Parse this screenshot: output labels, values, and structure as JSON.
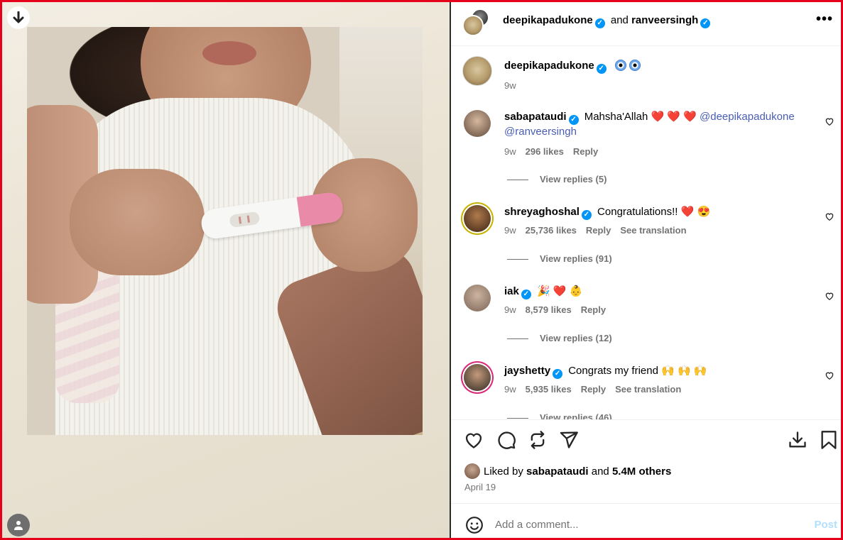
{
  "media": {
    "download_icon": "down-arrow-icon",
    "user_icon": "person-icon"
  },
  "header": {
    "user1": "deepikapadukone",
    "joiner": "and",
    "user2": "ranveersingh",
    "more": "•••"
  },
  "caption": {
    "username": "deepikapadukone",
    "emoji_icons": [
      "nazar-amulet-icon",
      "nazar-amulet-icon"
    ],
    "time": "9w"
  },
  "comments": [
    {
      "username": "sabapataudi",
      "text": "Mahsha'Allah ❤️ ❤️ ❤️",
      "mentions": [
        "@deepikapadukone",
        "@ranveersingh"
      ],
      "time": "9w",
      "likes": "296 likes",
      "reply": "Reply",
      "translate": "",
      "view_replies": "View replies (5)"
    },
    {
      "username": "shreyaghoshal",
      "text": "Congratulations!! ❤️ 😍",
      "mentions": [],
      "time": "9w",
      "likes": "25,736 likes",
      "reply": "Reply",
      "translate": "See translation",
      "view_replies": "View replies (91)"
    },
    {
      "username": "iak",
      "text": "🎉 ❤️ 👶",
      "mentions": [],
      "time": "9w",
      "likes": "8,579 likes",
      "reply": "Reply",
      "translate": "",
      "view_replies": "View replies (12)"
    },
    {
      "username": "jayshetty",
      "text": "Congrats my friend 🙌 🙌 🙌",
      "mentions": [],
      "time": "9w",
      "likes": "5,935 likes",
      "reply": "Reply",
      "translate": "See translation",
      "view_replies": "View replies (46)"
    }
  ],
  "liked": {
    "prefix": "Liked by",
    "user": "sabapataudi",
    "and": "and",
    "others": "5.4M others"
  },
  "date": "April 19",
  "add_comment": {
    "placeholder": "Add a comment...",
    "post": "Post"
  },
  "colors": {
    "verified": "#0095f6",
    "mention": "#4a5db5",
    "post_disabled": "#b2dffc",
    "frame": "#e5001c"
  }
}
